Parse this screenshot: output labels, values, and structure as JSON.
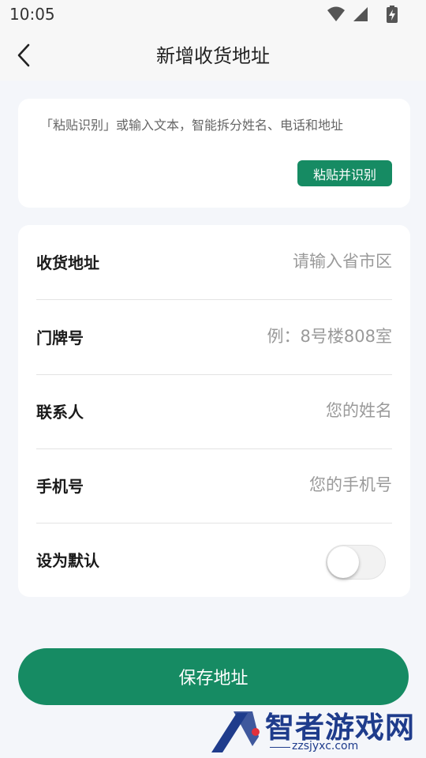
{
  "status_bar": {
    "time": "10:05",
    "icons": [
      "wifi-icon",
      "cell-signal-icon",
      "battery-charging-icon"
    ]
  },
  "nav": {
    "back_icon": "chevron-left-icon",
    "title": "新增收货地址"
  },
  "paste_card": {
    "hint": "「粘贴识别」或输入文本，智能拆分姓名、电话和地址",
    "button_label": "粘贴并识别"
  },
  "form": {
    "address": {
      "label": "收货地址",
      "placeholder": "请输入省市区",
      "value": ""
    },
    "door_number": {
      "label": "门牌号",
      "placeholder": "例：8号楼808室",
      "value": ""
    },
    "contact": {
      "label": "联系人",
      "placeholder": "您的姓名",
      "value": ""
    },
    "phone": {
      "label": "手机号",
      "placeholder": "您的手机号",
      "value": ""
    },
    "default": {
      "label": "设为默认",
      "enabled": false
    }
  },
  "save_button_label": "保存地址",
  "watermark": {
    "title": "智者游戏网",
    "url": "zzsjyxc.com"
  },
  "colors": {
    "accent": "#168b63",
    "background": "#f4f6fa",
    "card": "#ffffff",
    "placeholder": "#9a9a9a",
    "watermark": "#1f3c8c"
  }
}
